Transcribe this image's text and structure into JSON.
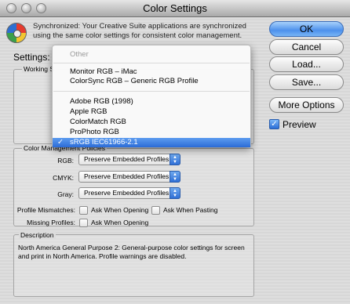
{
  "window": {
    "title": "Color Settings"
  },
  "sync": {
    "text": "Synchronized: Your Creative Suite applications are synchronized using the same color settings for consistent color management."
  },
  "settings": {
    "label": "Settings:"
  },
  "working_spaces": {
    "title": "Working S"
  },
  "color_mgmt": {
    "title": "Color Management Policies",
    "rgb_label": "RGB:",
    "rgb_value": "Preserve Embedded Profiles",
    "cmyk_label": "CMYK:",
    "cmyk_value": "Preserve Embedded Profiles",
    "gray_label": "Gray:",
    "gray_value": "Preserve Embedded Profiles",
    "mismatch_label": "Profile Mismatches:",
    "ask_opening": "Ask When Opening",
    "ask_pasting": "Ask When Pasting",
    "missing_label": "Missing Profiles:",
    "missing_ask_opening": "Ask When Opening"
  },
  "description": {
    "title": "Description",
    "text": "North America General Purpose 2:  General-purpose color settings for screen and print in North America. Profile warnings are disabled."
  },
  "buttons": {
    "ok": "OK",
    "cancel": "Cancel",
    "load": "Load...",
    "save": "Save...",
    "more_options": "More Options"
  },
  "preview": {
    "label": "Preview",
    "checked": true
  },
  "dropdown": {
    "items": [
      {
        "label": "Other",
        "disabled": true
      },
      {
        "label": "Monitor RGB – iMac"
      },
      {
        "label": "ColorSync RGB – Generic RGB Profile"
      },
      {
        "label": "Adobe RGB (1998)"
      },
      {
        "label": "Apple RGB"
      },
      {
        "label": "ColorMatch RGB"
      },
      {
        "label": "ProPhoto RGB"
      },
      {
        "label": "sRGB IEC61966-2.1",
        "selected": true
      }
    ],
    "check": "✓"
  },
  "colors": {
    "selection": "#2b6bd6",
    "button_primary": "#4d91ec"
  }
}
